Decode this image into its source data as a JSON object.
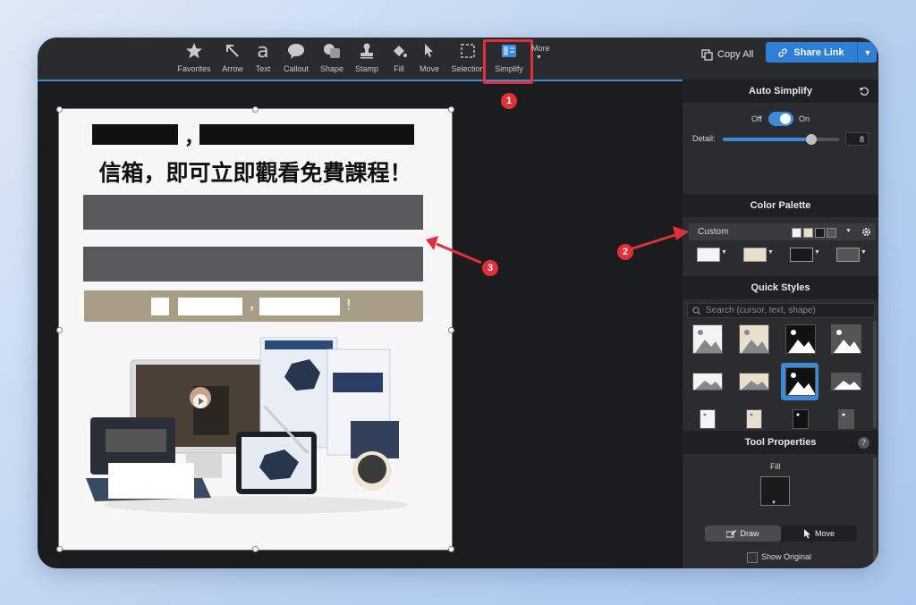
{
  "toolbar": {
    "tools": [
      {
        "label": "Favorites",
        "icon": "star-icon"
      },
      {
        "label": "Arrow",
        "icon": "arrow-icon"
      },
      {
        "label": "Text",
        "icon": "text-icon"
      },
      {
        "label": "Callout",
        "icon": "callout-icon"
      },
      {
        "label": "Shape",
        "icon": "shape-icon"
      },
      {
        "label": "Stamp",
        "icon": "stamp-icon"
      },
      {
        "label": "Fill",
        "icon": "fill-icon"
      },
      {
        "label": "Move",
        "icon": "move-icon"
      },
      {
        "label": "Selection",
        "icon": "selection-icon"
      },
      {
        "label": "Simplify",
        "icon": "simplify-icon"
      }
    ],
    "more_label": "More",
    "copy_all": "Copy All",
    "share_link": "Share Link",
    "accent": "#3d8ad8"
  },
  "canvas": {
    "headline": "信箱，即可立即觀看免費課程！",
    "comma": "，",
    "cta_comma": "，",
    "cta_exclaim": "！",
    "cta_color": "#a89d86",
    "field_color": "#58595c"
  },
  "panel": {
    "auto_simplify": {
      "title": "Auto Simplify",
      "off": "Off",
      "on": "On",
      "detail_label": "Detail:",
      "detail_value": "8",
      "detail_level": 0.8
    },
    "color_palette": {
      "title": "Color Palette",
      "preset": "Custom",
      "swatches": [
        "#f4f4f4",
        "#e8dfcc",
        "#1a1a1a",
        "#555555"
      ]
    },
    "quick_styles": {
      "title": "Quick Styles",
      "search_placeholder": "Search (cursor, text, shape)"
    },
    "tool_properties": {
      "title": "Tool Properties",
      "help": "?",
      "fill_label": "Fill",
      "draw": "Draw",
      "move": "Move",
      "show_original": "Show Original"
    }
  },
  "annotations": [
    "1",
    "2",
    "3"
  ]
}
